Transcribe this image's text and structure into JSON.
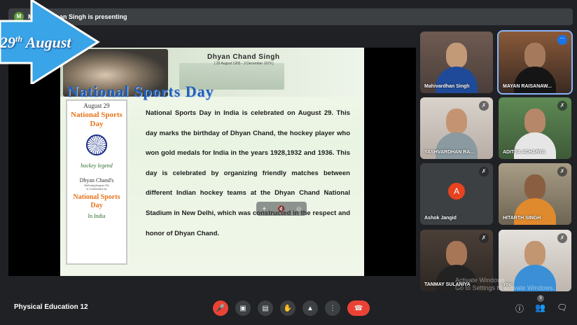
{
  "header": {
    "avatar_initial": "M",
    "presenting_text": "Mahivardhan Singh is presenting"
  },
  "overlay": {
    "date_num": "29",
    "date_sup": "th",
    "date_month": "August"
  },
  "slide": {
    "person_name": "Dhyan Chand Singh",
    "person_dates": "[ 29 August 1905 - 3 December 1979 ]",
    "title": "National Sports Day",
    "poster": {
      "date": "August 29",
      "title": "National Sports Day",
      "script_text": "hockey legend",
      "name": "Dhyan Chand's",
      "sub1": "Birthday(August 29)",
      "sub2": "is Celebrated as",
      "title2": "National Sports Day",
      "india": "In India"
    },
    "body": "National Sports Day in India is celebrated on August 29. This day marks the birthday of Dhyan Chand, the hockey player who won gold medals for India in the years 1928,1932 and 1936. This day is celebrated by organizing friendly matches between different Indian hockey teams at the Dhyan Chand National Stadium in New Delhi, which was constructed in the respect and honor of Dhyan Chand."
  },
  "participants": [
    {
      "name": "Mahivardhan Singh",
      "muted": false
    },
    {
      "name": "MAYAN RAISANAW...",
      "muted": false
    },
    {
      "name": "YASHVARDHAN RA...",
      "muted": true
    },
    {
      "name": "ADITYA ACHARYA",
      "muted": true
    },
    {
      "name": "Ashok Jangid",
      "muted": true,
      "avatar": "A"
    },
    {
      "name": "HITARTH SINGH",
      "muted": true
    },
    {
      "name": "TANMAY SULANIYA",
      "muted": true
    },
    {
      "name": "You",
      "muted": true
    }
  ],
  "watermark": {
    "line1": "Activate Windows",
    "line2": "Go to Settings to activate Windows."
  },
  "footer": {
    "meeting_title": "Physical Education 12",
    "people_count": "9"
  },
  "colors": {
    "accent_red": "#ea4335",
    "panel": "#3c4043",
    "background": "#202124",
    "slide_title": "#1f5fb8"
  }
}
